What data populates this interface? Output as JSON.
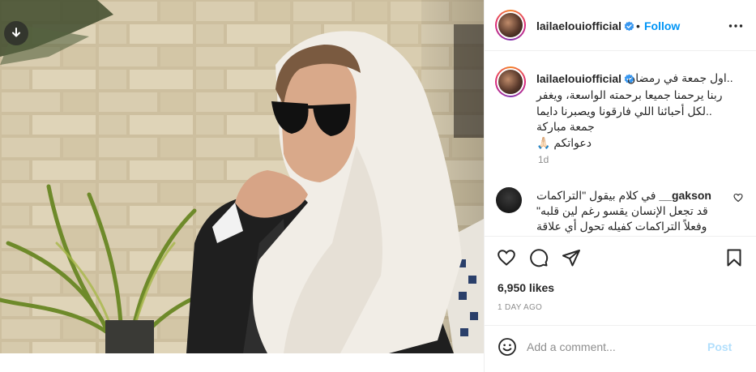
{
  "post": {
    "username": "lailaeloui​official",
    "follow_label": "Follow",
    "dot": "•",
    "caption": {
      "line1": "..اول جمعة في رمضان",
      "line2": "ربنا يرحمنا جميعا برحمته الواسعة، ويغفر",
      "line3": "..لكل أحبائنا اللي فارقونا ويصبرنا دايما",
      "line4": "جمعة مباركة",
      "line5": "دعواتكم 🙏🏻",
      "time": "1d"
    },
    "comment": {
      "user": "gakson__",
      "line1": "في كلام بيقول \"التراكمات",
      "line2": "قد تجعل الإنسان يقسو رغم لين قلبه\"",
      "line3": "وفعلاً التراكمات كفيله تحول أي علاقة"
    },
    "likes": "6,950 likes",
    "posted_ago": "1 DAY AGO",
    "add_comment_placeholder": "Add a comment...",
    "post_label": "Post"
  },
  "colors": {
    "accent": "#0095f6",
    "post_disabled": "#b2dffc",
    "verified": "#3897f0",
    "muted": "#8e8e8e"
  },
  "icons": [
    "download-icon",
    "verified-badge-icon",
    "more-options-icon",
    "heart-icon",
    "comment-icon",
    "share-icon",
    "bookmark-icon",
    "emoji-icon"
  ]
}
